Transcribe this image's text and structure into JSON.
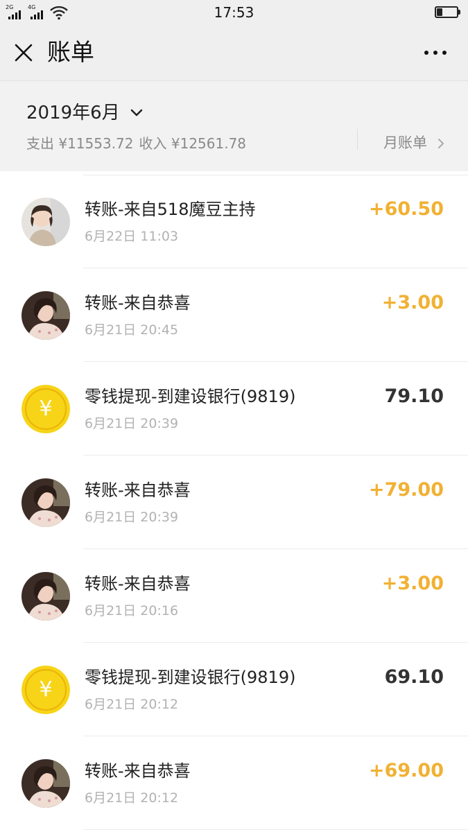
{
  "status_bar": {
    "sim1_label": "2G",
    "sim2_label": "4G",
    "time": "17:53",
    "icons": [
      "signal-icon",
      "wifi-icon",
      "battery-icon"
    ]
  },
  "nav": {
    "close_icon": "close-icon",
    "title": "账单",
    "more_icon": "more-icon"
  },
  "summary": {
    "month": "2019年6月",
    "expense_text": "支出 ¥11553.72",
    "income_text": "收入 ¥12561.78",
    "monthly_bill_label": "月账单"
  },
  "colors": {
    "income": "#f1b133",
    "expense": "#333333",
    "coin": "#f7d417",
    "header_bg": "#efefef"
  },
  "transactions": [
    {
      "title": "转账-来自518魔豆主持",
      "time": "6月22日 11:03",
      "amount": "+60.50",
      "type": "income",
      "icon": "avatar-child"
    },
    {
      "title": "转账-来自恭喜",
      "time": "6月21日 20:45",
      "amount": "+3.00",
      "type": "income",
      "icon": "avatar-woman"
    },
    {
      "title": "零钱提现-到建设银行(9819)",
      "time": "6月21日 20:39",
      "amount": "79.10",
      "type": "expense",
      "icon": "yuan-coin-icon",
      "coin_glyph": "¥"
    },
    {
      "title": "转账-来自恭喜",
      "time": "6月21日 20:39",
      "amount": "+79.00",
      "type": "income",
      "icon": "avatar-woman"
    },
    {
      "title": "转账-来自恭喜",
      "time": "6月21日 20:16",
      "amount": "+3.00",
      "type": "income",
      "icon": "avatar-woman"
    },
    {
      "title": "零钱提现-到建设银行(9819)",
      "time": "6月21日 20:12",
      "amount": "69.10",
      "type": "expense",
      "icon": "yuan-coin-icon",
      "coin_glyph": "¥"
    },
    {
      "title": "转账-来自恭喜",
      "time": "6月21日 20:12",
      "amount": "+69.00",
      "type": "income",
      "icon": "avatar-woman"
    }
  ]
}
